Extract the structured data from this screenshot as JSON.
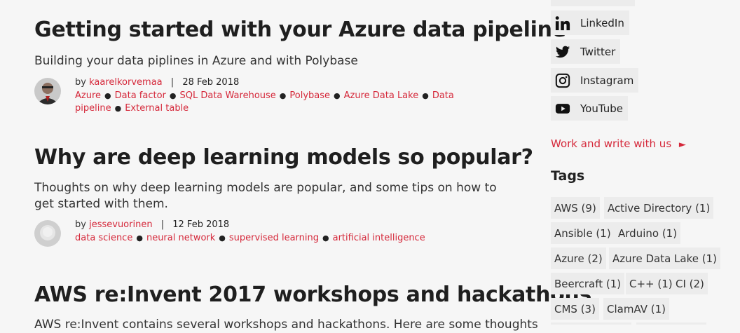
{
  "posts": [
    {
      "title": "Getting started with your Azure data pipeline",
      "description": "Building your data piplines in Azure and with Polybase",
      "by": "by",
      "author": "kaarelkorvemaa",
      "date": "28 Feb 2018",
      "tags": [
        "Azure",
        "Data factor",
        "SQL Data Warehouse",
        "Polybase",
        "Azure Data Lake",
        "Data pipeline",
        "External table"
      ]
    },
    {
      "title": "Why are deep learning models so popular?",
      "description": "Thoughts on why deep learning models are popular, and some tips on how to get started with them.",
      "by": "by",
      "author": "jessevuorinen",
      "date": "12 Feb 2018",
      "tags": [
        "data science",
        "neural network",
        "supervised learning",
        "artificial intelligence"
      ]
    },
    {
      "title": "AWS re:Invent 2017 workshops and hackathons",
      "description": "AWS re:Invent contains several workshops and hackathons. Here are some thoughts"
    }
  ],
  "separator": "|",
  "sidebar": {
    "social": [
      {
        "label": "LinkedIn",
        "icon": "linkedin-icon"
      },
      {
        "label": "Twitter",
        "icon": "twitter-icon"
      },
      {
        "label": "Instagram",
        "icon": "instagram-icon"
      },
      {
        "label": "YouTube",
        "icon": "youtube-icon"
      }
    ],
    "work_link": "Work and write with us",
    "work_arrow": "►",
    "tags_title": "Tags",
    "tags": [
      "AWS (9)",
      "Active Directory (1)",
      "Ansible (1)",
      "Arduino (1)",
      "Azure (2)",
      "Azure Data Lake (1)",
      "Beercraft (1)",
      "C++ (1)",
      "CI (2)",
      "CMS (3)",
      "ClamAV (1)"
    ]
  },
  "colors": {
    "accent": "#d5283a",
    "background": "#f6f6f6",
    "chip": "#ececec"
  }
}
